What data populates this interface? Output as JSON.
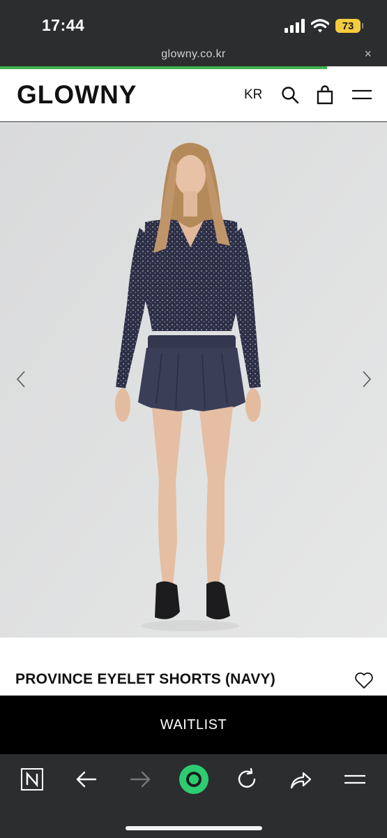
{
  "status_bar": {
    "time": "17:44",
    "battery": "73",
    "battery_color": "#f5cc3d"
  },
  "browser": {
    "url": "glowny.co.kr",
    "close_label": "×",
    "load_progress": 0.845,
    "progress_color": "#3fb34f"
  },
  "header": {
    "logo": "GLOWNY",
    "language": "KR",
    "icons": [
      "search-icon",
      "shopping-bag-icon",
      "hamburger-menu-icon"
    ]
  },
  "product": {
    "image_icon": "product-photo",
    "title": "PROVINCE EYELET SHORTS (NAVY)",
    "wishlist_icon": "heart-outline-icon",
    "cta": "WAITLIST",
    "carousel": [
      "chevron-left-icon",
      "chevron-right-icon"
    ]
  },
  "toolbar": {
    "icons": [
      "naver-n-icon",
      "back-arrow-icon",
      "forward-arrow-icon",
      "green-dot-icon",
      "reload-icon",
      "share-icon",
      "menu-icon"
    ],
    "accent": "#2ecc71"
  }
}
